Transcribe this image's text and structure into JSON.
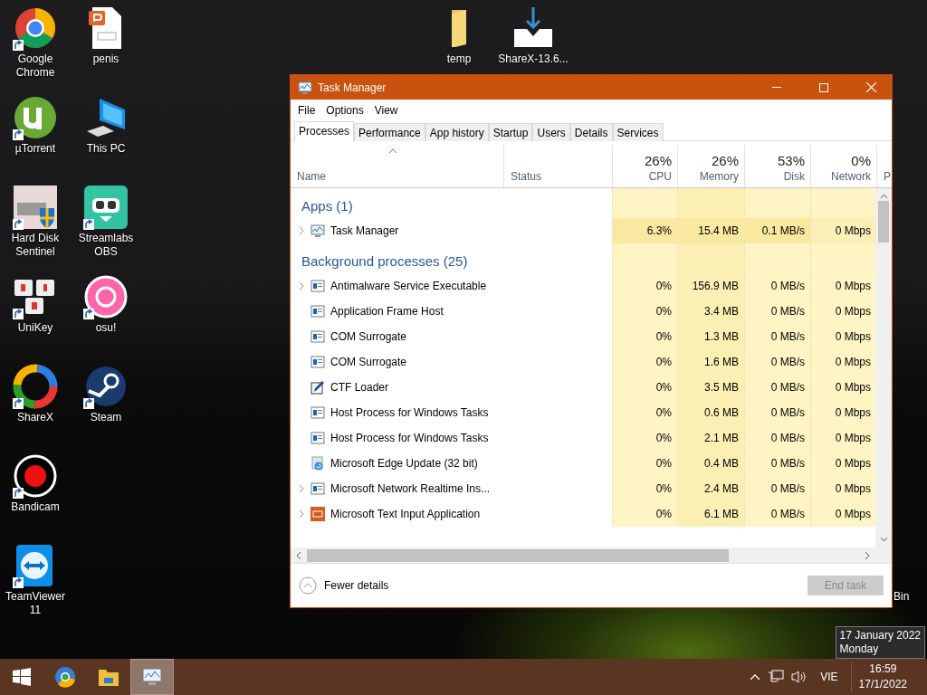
{
  "desktop": {
    "icons": [
      {
        "label": "Google Chrome",
        "kind": "chrome",
        "shortcut": true
      },
      {
        "label": "µTorrent",
        "kind": "torrent",
        "shortcut": true
      },
      {
        "label": "Hard Disk Sentinel",
        "kind": "disk",
        "shortcut": true
      },
      {
        "label": "UniKey",
        "kind": "unikey",
        "shortcut": true
      },
      {
        "label": "ShareX",
        "kind": "sharex",
        "shortcut": true
      },
      {
        "label": "Bandicam",
        "kind": "record",
        "shortcut": true
      },
      {
        "label": "TeamViewer 11",
        "kind": "teamviewer",
        "shortcut": true
      },
      {
        "label": "penis",
        "kind": "document",
        "shortcut": false
      },
      {
        "label": "This PC",
        "kind": "computer",
        "shortcut": false
      },
      {
        "label": "Streamlabs OBS",
        "kind": "streamlabs",
        "shortcut": true
      },
      {
        "label": "osu!",
        "kind": "osu",
        "shortcut": true
      },
      {
        "label": "Steam",
        "kind": "steam",
        "shortcut": true
      }
    ],
    "top_icons": [
      {
        "label": "temp",
        "kind": "folder",
        "shortcut": false
      },
      {
        "label": "ShareX-13.6...",
        "kind": "installer",
        "shortcut": false
      }
    ],
    "partial_icon": {
      "label": "Bin"
    }
  },
  "task_manager": {
    "title": "Task Manager",
    "menu": [
      "File",
      "Options",
      "View"
    ],
    "tabs": [
      {
        "label": "Processes",
        "selected": true
      },
      {
        "label": "Performance",
        "selected": false
      },
      {
        "label": "App history",
        "selected": false
      },
      {
        "label": "Startup",
        "selected": false
      },
      {
        "label": "Users",
        "selected": false
      },
      {
        "label": "Details",
        "selected": false
      },
      {
        "label": "Services",
        "selected": false
      }
    ],
    "columns": [
      {
        "label": "Name"
      },
      {
        "label": "Status"
      },
      {
        "percent": "26%",
        "label": "CPU"
      },
      {
        "percent": "26%",
        "label": "Memory"
      },
      {
        "percent": "53%",
        "label": "Disk"
      },
      {
        "percent": "0%",
        "label": "Network"
      },
      {
        "label": "P"
      }
    ],
    "sections": [
      {
        "heading": "Apps (1)",
        "rows": [
          {
            "name": "Task Manager",
            "kind": "taskmgr",
            "expandable": true,
            "selected": false,
            "cpu": "6.3%",
            "memory": "15.4 MB",
            "disk": "0.1 MB/s",
            "network": "0 Mbps"
          }
        ]
      },
      {
        "heading": "Background processes (25)",
        "rows": [
          {
            "name": "Antimalware Service Executable",
            "kind": "window",
            "expandable": true,
            "selected": false,
            "cpu": "0%",
            "memory": "156.9 MB",
            "disk": "0 MB/s",
            "network": "0 Mbps"
          },
          {
            "name": "Application Frame Host",
            "kind": "window",
            "expandable": false,
            "selected": false,
            "cpu": "0%",
            "memory": "3.4 MB",
            "disk": "0 MB/s",
            "network": "0 Mbps"
          },
          {
            "name": "COM Surrogate",
            "kind": "window",
            "expandable": false,
            "selected": false,
            "cpu": "0%",
            "memory": "1.3 MB",
            "disk": "0 MB/s",
            "network": "0 Mbps"
          },
          {
            "name": "COM Surrogate",
            "kind": "window",
            "expandable": false,
            "selected": false,
            "cpu": "0%",
            "memory": "1.6 MB",
            "disk": "0 MB/s",
            "network": "0 Mbps"
          },
          {
            "name": "CTF Loader",
            "kind": "pen",
            "expandable": false,
            "selected": false,
            "cpu": "0%",
            "memory": "3.5 MB",
            "disk": "0 MB/s",
            "network": "0 Mbps"
          },
          {
            "name": "Host Process for Windows Tasks",
            "kind": "window",
            "expandable": false,
            "selected": false,
            "cpu": "0%",
            "memory": "0.6 MB",
            "disk": "0 MB/s",
            "network": "0 Mbps"
          },
          {
            "name": "Host Process for Windows Tasks",
            "kind": "window",
            "expandable": false,
            "selected": false,
            "cpu": "0%",
            "memory": "2.1 MB",
            "disk": "0 MB/s",
            "network": "0 Mbps"
          },
          {
            "name": "Microsoft Edge Update (32 bit)",
            "kind": "update",
            "expandable": false,
            "selected": false,
            "cpu": "0%",
            "memory": "0.4 MB",
            "disk": "0 MB/s",
            "network": "0 Mbps"
          },
          {
            "name": "Microsoft Network Realtime Ins...",
            "kind": "window",
            "expandable": true,
            "selected": false,
            "cpu": "0%",
            "memory": "2.4 MB",
            "disk": "0 MB/s",
            "network": "0 Mbps"
          },
          {
            "name": "Microsoft Text Input Application",
            "kind": "textinput",
            "expandable": true,
            "selected": false,
            "cpu": "0%",
            "memory": "6.1 MB",
            "disk": "0 MB/s",
            "network": "0 Mbps"
          }
        ]
      }
    ],
    "fewer_details": "Fewer details",
    "end_task": {
      "label": "End task",
      "disabled": true
    }
  },
  "tooltip": {
    "lines": [
      "17 January 2022",
      "Monday"
    ]
  },
  "taskbar": {
    "apps": [
      {
        "kind": "start",
        "selected": false
      },
      {
        "kind": "browser",
        "selected": false
      },
      {
        "kind": "explorer",
        "selected": false
      },
      {
        "kind": "taskmgr",
        "selected": true
      }
    ],
    "tray": {
      "language": "VIE",
      "time": "16:59",
      "date": "17/1/2022"
    }
  }
}
